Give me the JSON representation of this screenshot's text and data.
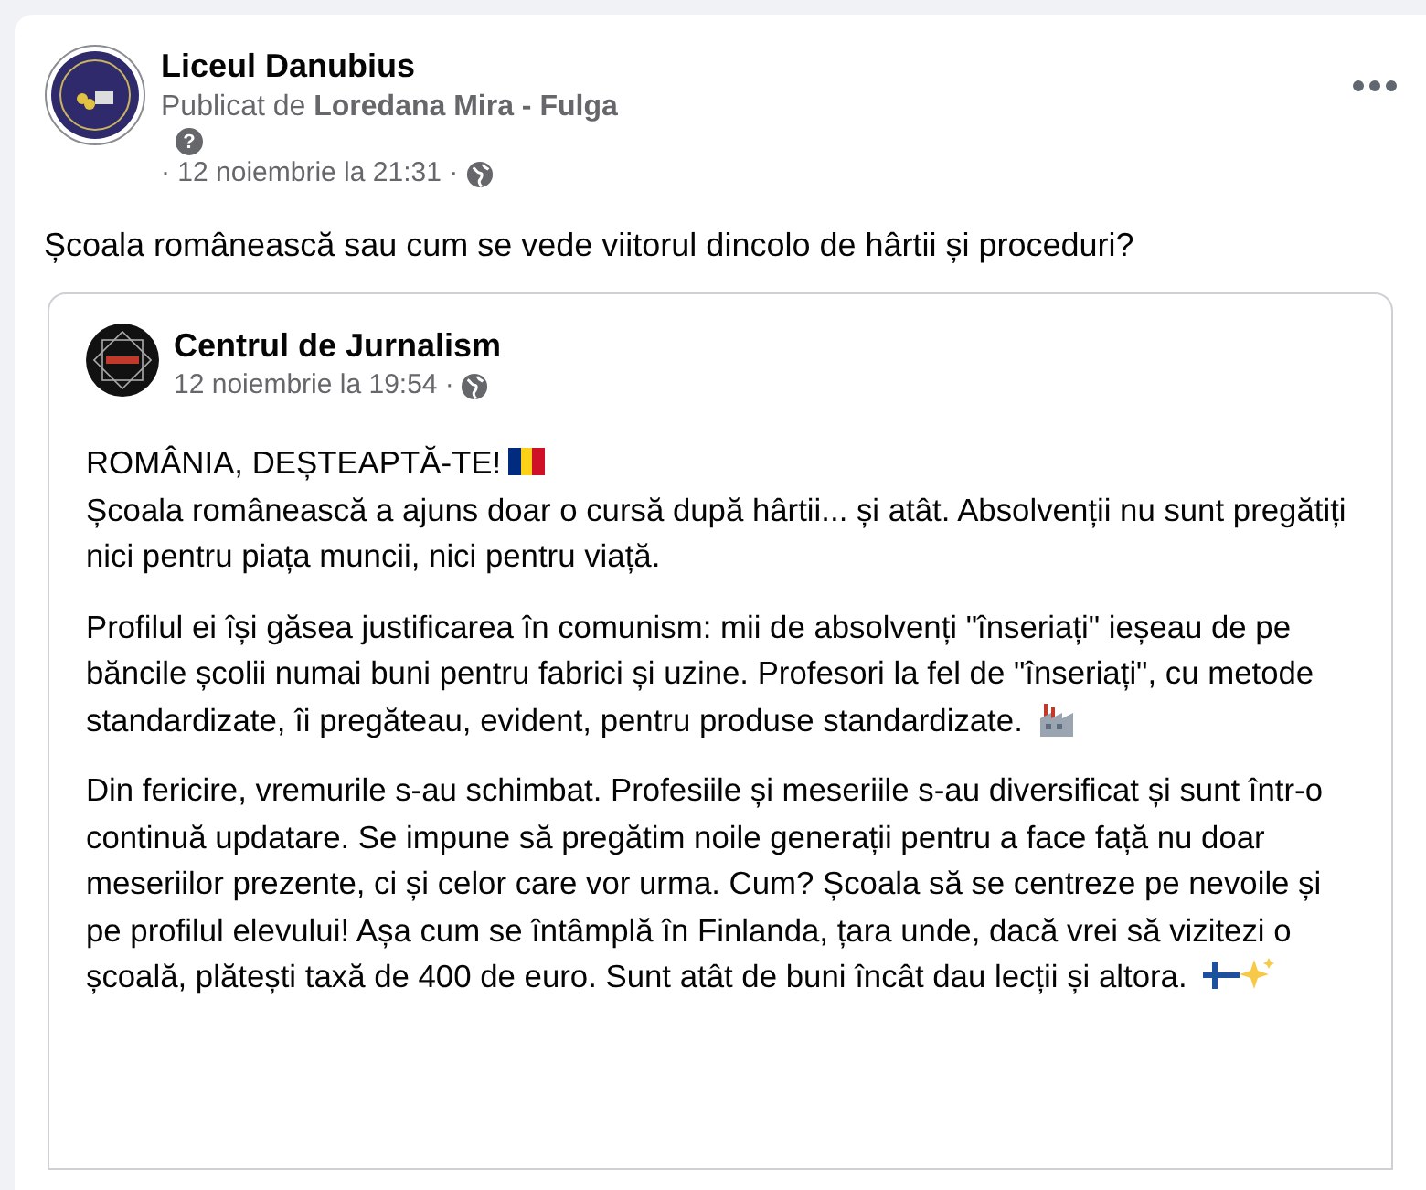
{
  "post": {
    "page_name": "Liceul Danubius",
    "byline_prefix": "Publicat de",
    "author": "Loredana Mira - Fulga",
    "help_mark": "?",
    "timestamp": "· 12 noiembrie la 21:31 ·",
    "text": "Școala românească sau cum se vede viitorul dincolo de hârtii și proceduri?"
  },
  "shared": {
    "page_name": "Centrul de Jurnalism",
    "timestamp": "12 noiembrie la 19:54 ·",
    "heading": "ROMÂNIA, DEȘTEAPTĂ-TE!",
    "paragraphs": [
      "Școala românească a ajuns doar o cursă după hârtii... și atât. Absolvenții nu sunt pregătiți nici pentru piața muncii, nici pentru viață.",
      "Profilul ei își găsea justificarea în comunism: mii de absolvenți \"înseriați\" ieșeau de pe băncile școlii numai buni pentru fabrici și uzine. Profesori la fel de \"înseriați\", cu metode standardizate, îi pregăteau, evident, pentru produse standardizate.",
      "Din fericire, vremurile s-au schimbat. Profesiile și meseriile s-au diversificat și sunt într-o continuă updatare. Se impune să pregătim noile generații pentru a face față nu doar meseriilor prezente, ci și celor care vor urma. Cum? Școala să se centreze pe nevoile și pe profilul elevului! Așa cum se întâmplă în Finlanda, țara unde, dacă vrei să vizitezi o școală, plătești taxă de 400 de euro. Sunt atât de buni încât dau lecții și altora."
    ]
  }
}
